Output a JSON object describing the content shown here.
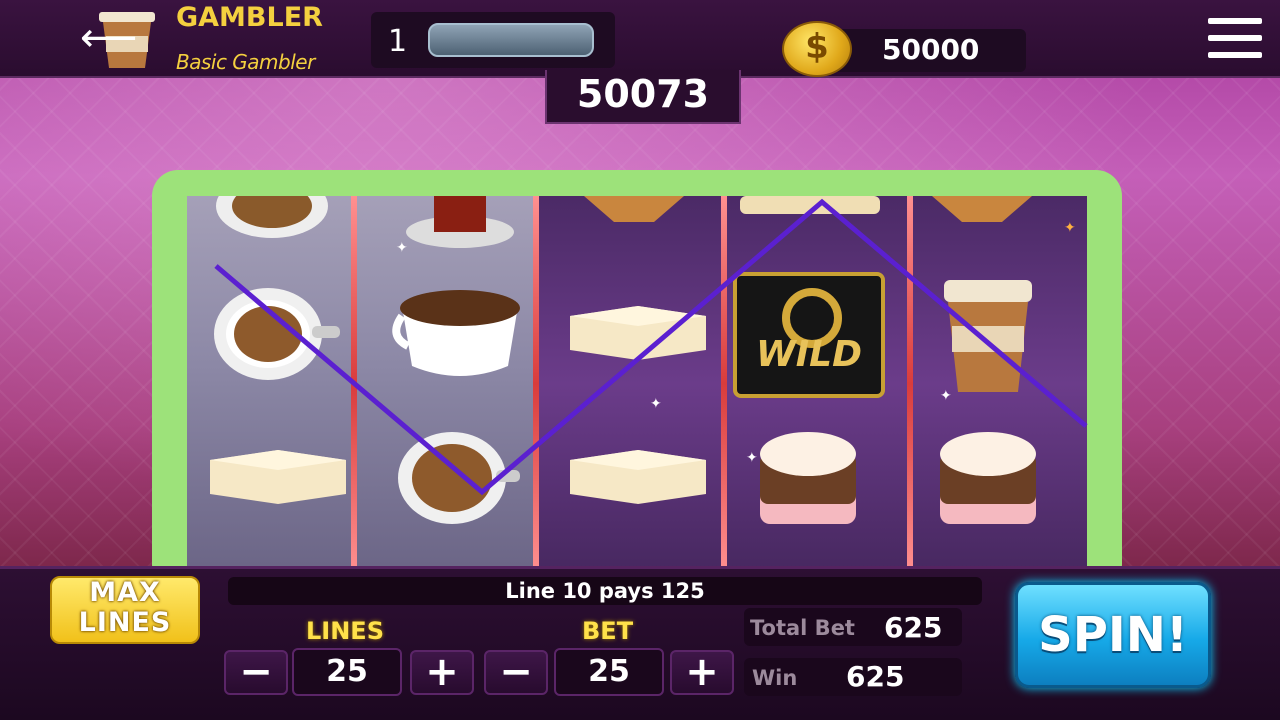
{
  "header": {
    "title": "GAMBLER",
    "subtitle": "Basic Gambler",
    "level": "1",
    "coins": "50000",
    "back_icon": "back-arrow-icon",
    "menu_icon": "hamburger-menu-icon"
  },
  "jackpot": "50073",
  "reels": {
    "wild_label": "WILD",
    "symbols": [
      [
        "coffee-cup-top",
        "coffee-cup",
        "cheesecake-slice"
      ],
      [
        "tea-glass",
        "espresso-cup",
        "coffee-cup"
      ],
      [
        "waffle",
        "cheesecake-slice",
        "cheesecake-slice"
      ],
      [
        "waffle",
        "wild",
        "layer-cake"
      ],
      [
        "waffle",
        "takeaway-cup",
        "layer-cake"
      ]
    ]
  },
  "status_message": "Line 10 pays 125",
  "controls": {
    "max_lines_label_1": "MAX",
    "max_lines_label_2": "LINES",
    "lines_label": "LINES",
    "lines_value": "25",
    "bet_label": "BET",
    "bet_value": "25",
    "minus": "−",
    "plus": "+",
    "total_bet_label": "Total Bet",
    "total_bet_value": "625",
    "win_label": "Win",
    "win_value": "625",
    "spin_label": "SPIN!"
  },
  "colors": {
    "payline": "#5b20d0",
    "frame": "#9de27a",
    "accent": "#ffe14a",
    "spin": "#16a9e8"
  }
}
